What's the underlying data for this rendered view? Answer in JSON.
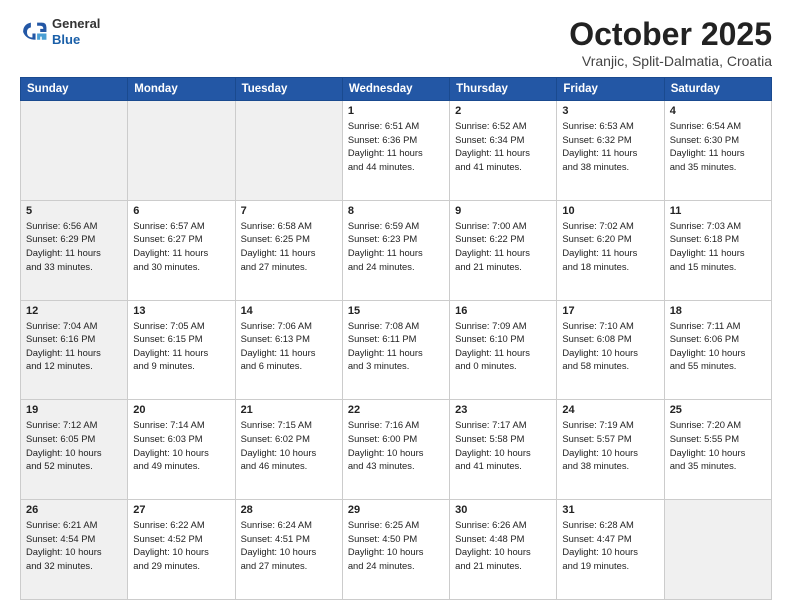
{
  "header": {
    "logo_general": "General",
    "logo_blue": "Blue",
    "month": "October 2025",
    "location": "Vranjic, Split-Dalmatia, Croatia"
  },
  "days_of_week": [
    "Sunday",
    "Monday",
    "Tuesday",
    "Wednesday",
    "Thursday",
    "Friday",
    "Saturday"
  ],
  "weeks": [
    [
      {
        "day": "",
        "info": "",
        "shaded": true
      },
      {
        "day": "",
        "info": "",
        "shaded": true
      },
      {
        "day": "",
        "info": "",
        "shaded": true
      },
      {
        "day": "1",
        "info": "Sunrise: 6:51 AM\nSunset: 6:36 PM\nDaylight: 11 hours\nand 44 minutes.",
        "shaded": false
      },
      {
        "day": "2",
        "info": "Sunrise: 6:52 AM\nSunset: 6:34 PM\nDaylight: 11 hours\nand 41 minutes.",
        "shaded": false
      },
      {
        "day": "3",
        "info": "Sunrise: 6:53 AM\nSunset: 6:32 PM\nDaylight: 11 hours\nand 38 minutes.",
        "shaded": false
      },
      {
        "day": "4",
        "info": "Sunrise: 6:54 AM\nSunset: 6:30 PM\nDaylight: 11 hours\nand 35 minutes.",
        "shaded": false
      }
    ],
    [
      {
        "day": "5",
        "info": "Sunrise: 6:56 AM\nSunset: 6:29 PM\nDaylight: 11 hours\nand 33 minutes.",
        "shaded": true
      },
      {
        "day": "6",
        "info": "Sunrise: 6:57 AM\nSunset: 6:27 PM\nDaylight: 11 hours\nand 30 minutes.",
        "shaded": false
      },
      {
        "day": "7",
        "info": "Sunrise: 6:58 AM\nSunset: 6:25 PM\nDaylight: 11 hours\nand 27 minutes.",
        "shaded": false
      },
      {
        "day": "8",
        "info": "Sunrise: 6:59 AM\nSunset: 6:23 PM\nDaylight: 11 hours\nand 24 minutes.",
        "shaded": false
      },
      {
        "day": "9",
        "info": "Sunrise: 7:00 AM\nSunset: 6:22 PM\nDaylight: 11 hours\nand 21 minutes.",
        "shaded": false
      },
      {
        "day": "10",
        "info": "Sunrise: 7:02 AM\nSunset: 6:20 PM\nDaylight: 11 hours\nand 18 minutes.",
        "shaded": false
      },
      {
        "day": "11",
        "info": "Sunrise: 7:03 AM\nSunset: 6:18 PM\nDaylight: 11 hours\nand 15 minutes.",
        "shaded": false
      }
    ],
    [
      {
        "day": "12",
        "info": "Sunrise: 7:04 AM\nSunset: 6:16 PM\nDaylight: 11 hours\nand 12 minutes.",
        "shaded": true
      },
      {
        "day": "13",
        "info": "Sunrise: 7:05 AM\nSunset: 6:15 PM\nDaylight: 11 hours\nand 9 minutes.",
        "shaded": false
      },
      {
        "day": "14",
        "info": "Sunrise: 7:06 AM\nSunset: 6:13 PM\nDaylight: 11 hours\nand 6 minutes.",
        "shaded": false
      },
      {
        "day": "15",
        "info": "Sunrise: 7:08 AM\nSunset: 6:11 PM\nDaylight: 11 hours\nand 3 minutes.",
        "shaded": false
      },
      {
        "day": "16",
        "info": "Sunrise: 7:09 AM\nSunset: 6:10 PM\nDaylight: 11 hours\nand 0 minutes.",
        "shaded": false
      },
      {
        "day": "17",
        "info": "Sunrise: 7:10 AM\nSunset: 6:08 PM\nDaylight: 10 hours\nand 58 minutes.",
        "shaded": false
      },
      {
        "day": "18",
        "info": "Sunrise: 7:11 AM\nSunset: 6:06 PM\nDaylight: 10 hours\nand 55 minutes.",
        "shaded": false
      }
    ],
    [
      {
        "day": "19",
        "info": "Sunrise: 7:12 AM\nSunset: 6:05 PM\nDaylight: 10 hours\nand 52 minutes.",
        "shaded": true
      },
      {
        "day": "20",
        "info": "Sunrise: 7:14 AM\nSunset: 6:03 PM\nDaylight: 10 hours\nand 49 minutes.",
        "shaded": false
      },
      {
        "day": "21",
        "info": "Sunrise: 7:15 AM\nSunset: 6:02 PM\nDaylight: 10 hours\nand 46 minutes.",
        "shaded": false
      },
      {
        "day": "22",
        "info": "Sunrise: 7:16 AM\nSunset: 6:00 PM\nDaylight: 10 hours\nand 43 minutes.",
        "shaded": false
      },
      {
        "day": "23",
        "info": "Sunrise: 7:17 AM\nSunset: 5:58 PM\nDaylight: 10 hours\nand 41 minutes.",
        "shaded": false
      },
      {
        "day": "24",
        "info": "Sunrise: 7:19 AM\nSunset: 5:57 PM\nDaylight: 10 hours\nand 38 minutes.",
        "shaded": false
      },
      {
        "day": "25",
        "info": "Sunrise: 7:20 AM\nSunset: 5:55 PM\nDaylight: 10 hours\nand 35 minutes.",
        "shaded": false
      }
    ],
    [
      {
        "day": "26",
        "info": "Sunrise: 6:21 AM\nSunset: 4:54 PM\nDaylight: 10 hours\nand 32 minutes.",
        "shaded": true
      },
      {
        "day": "27",
        "info": "Sunrise: 6:22 AM\nSunset: 4:52 PM\nDaylight: 10 hours\nand 29 minutes.",
        "shaded": false
      },
      {
        "day": "28",
        "info": "Sunrise: 6:24 AM\nSunset: 4:51 PM\nDaylight: 10 hours\nand 27 minutes.",
        "shaded": false
      },
      {
        "day": "29",
        "info": "Sunrise: 6:25 AM\nSunset: 4:50 PM\nDaylight: 10 hours\nand 24 minutes.",
        "shaded": false
      },
      {
        "day": "30",
        "info": "Sunrise: 6:26 AM\nSunset: 4:48 PM\nDaylight: 10 hours\nand 21 minutes.",
        "shaded": false
      },
      {
        "day": "31",
        "info": "Sunrise: 6:28 AM\nSunset: 4:47 PM\nDaylight: 10 hours\nand 19 minutes.",
        "shaded": false
      },
      {
        "day": "",
        "info": "",
        "shaded": true
      }
    ]
  ]
}
